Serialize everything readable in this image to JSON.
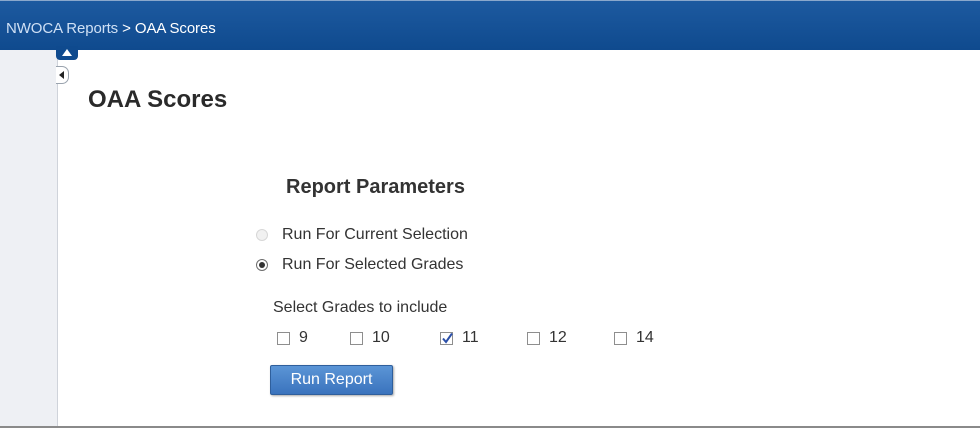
{
  "breadcrumb": {
    "parent": "NWOCA Reports",
    "separator": ">",
    "current": "OAA Scores"
  },
  "page": {
    "title": "OAA Scores"
  },
  "parameters": {
    "heading": "Report Parameters",
    "options": [
      {
        "label": "Run For Current Selection",
        "selected": false,
        "disabled": true
      },
      {
        "label": "Run For Selected Grades",
        "selected": true,
        "disabled": false
      }
    ],
    "grades_label": "Select Grades to include",
    "grades": [
      {
        "label": "9",
        "checked": false
      },
      {
        "label": "10",
        "checked": false
      },
      {
        "label": "11",
        "checked": true
      },
      {
        "label": "12",
        "checked": false
      },
      {
        "label": "14",
        "checked": false
      }
    ],
    "run_button": "Run Report"
  },
  "icons": {
    "collapse_top": "chevron-up-icon",
    "collapse_side": "chevron-left-icon"
  },
  "colors": {
    "header_bg": "#0f4a8e",
    "button_bg": "#3a73bd"
  }
}
